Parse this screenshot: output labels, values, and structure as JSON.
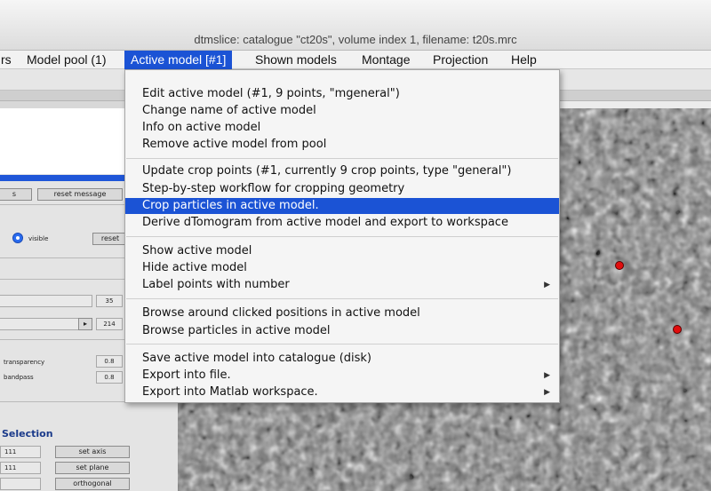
{
  "window": {
    "title": "dtmslice: catalogue \"ct20s\", volume index 1, filename: t20s.mrc"
  },
  "menubar": {
    "items": [
      {
        "label": "rs"
      },
      {
        "label": "Model pool (1)"
      },
      {
        "label": "Active model [#1]"
      },
      {
        "label": "Shown models"
      },
      {
        "label": "Montage"
      },
      {
        "label": "Projection"
      },
      {
        "label": "Help"
      }
    ]
  },
  "dropdown": {
    "groups": [
      [
        "Edit active model (#1, 9 points, \"mgeneral\")",
        "Change name of active model",
        "Info on active model",
        "Remove active model from pool"
      ],
      [
        "Update crop points (#1, currently 9 crop points, type \"general\")",
        "Step-by-step workflow for cropping geometry",
        "Crop particles in active model.",
        "Derive dTomogram from active model and export to workspace"
      ],
      [
        "Show active model",
        "Hide active model",
        "Label points with number"
      ],
      [
        "Browse around clicked positions in active model",
        "Browse particles in active model"
      ],
      [
        "Save active model into catalogue (disk)",
        "Export into file.",
        "Export into Matlab workspace."
      ]
    ],
    "highlighted": "Crop particles in active model.",
    "submenu_arrow": "▶"
  },
  "leftpanel": {
    "btn_s": "s",
    "reset_message": "reset message",
    "visible_label": "visible",
    "reset_label": "reset",
    "value_35": "35",
    "value_214": "214",
    "transparency_label": "transparency",
    "transparency_value": "0.8",
    "bandpass_label": "bandpass",
    "bandpass_value": "0.8",
    "selection_title": "Selection",
    "sel_vals": [
      "111",
      "111"
    ],
    "set_axis": "set axis",
    "set_plane": "set plane",
    "orthogonal": "orthogonal"
  },
  "colors": {
    "accent": "#1b53d5",
    "marker": "#e10d0d"
  }
}
